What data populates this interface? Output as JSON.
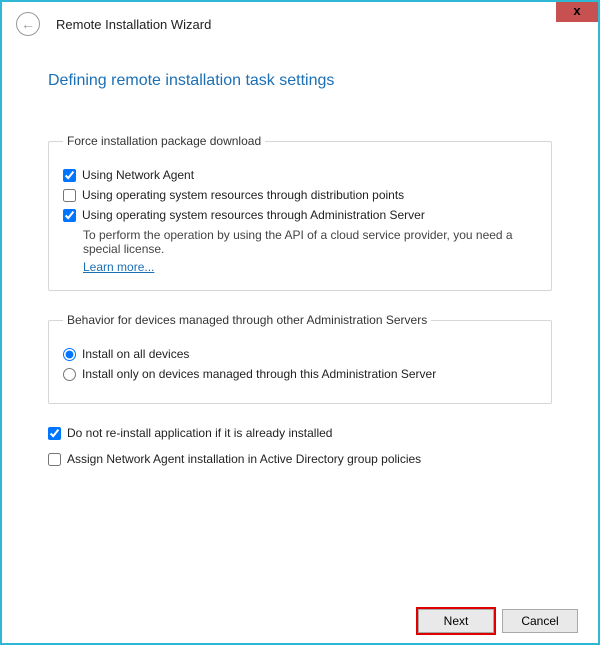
{
  "window": {
    "title": "Remote Installation Wizard",
    "close_glyph": "x"
  },
  "page": {
    "title": "Defining remote installation task settings"
  },
  "force_download": {
    "legend": "Force installation package download",
    "using_network_agent": {
      "label": "Using Network Agent",
      "checked": true
    },
    "using_os_distribution": {
      "label": "Using operating system resources through distribution points",
      "checked": false
    },
    "using_os_admin_server": {
      "label": "Using operating system resources through Administration Server",
      "checked": true,
      "note": "To perform the operation by using the API of a cloud service provider, you need a special license.",
      "learn_more": "Learn more..."
    }
  },
  "behavior": {
    "legend": "Behavior for devices managed through other Administration Servers",
    "install_all": {
      "label": "Install on all devices",
      "selected": true
    },
    "install_only_this": {
      "label": "Install only on devices managed through this Administration Server",
      "selected": false
    }
  },
  "other": {
    "do_not_reinstall": {
      "label": "Do not re-install application if it is already installed",
      "checked": true
    },
    "assign_agent_ad": {
      "label": "Assign Network Agent installation in Active Directory group policies",
      "checked": false
    }
  },
  "buttons": {
    "next": "Next",
    "cancel": "Cancel",
    "back_glyph": "←"
  }
}
